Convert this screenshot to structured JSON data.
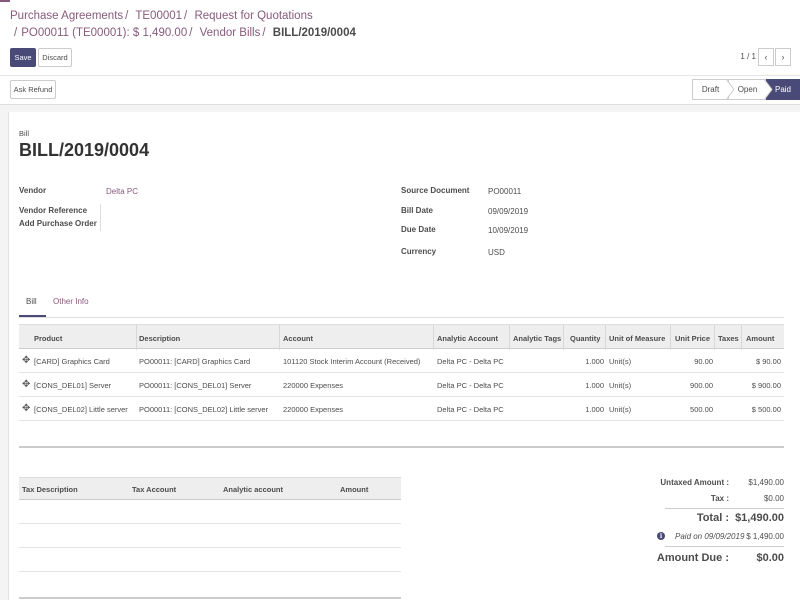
{
  "breadcrumb": {
    "line1": [
      "Purchase Agreements",
      "TE00001",
      "Request for Quotations"
    ],
    "line2": [
      "PO00011 (TE00001): $ 1,490.00",
      "Vendor Bills"
    ],
    "current": "BILL/2019/0004",
    "separator": "/"
  },
  "toolbar": {
    "save_label": "Save",
    "discard_label": "Discard",
    "pager": "1 / 1",
    "prev_icon": "‹",
    "next_icon": "›"
  },
  "actions": {
    "ask_refund_label": "Ask Refund"
  },
  "statusbar": {
    "draft": "Draft",
    "open": "Open",
    "paid": "Paid",
    "active": "paid"
  },
  "doc": {
    "kind": "Bill",
    "name": "BILL/2019/0004"
  },
  "fields_left": {
    "vendor_label": "Vendor",
    "vendor_value": "Delta PC",
    "vendor_ref_label": "Vendor Reference",
    "add_po_label": "Add Purchase Order"
  },
  "fields_right": {
    "source_label": "Source Document",
    "source_value": "PO00011",
    "bill_date_label": "Bill Date",
    "bill_date_value": "09/09/2019",
    "due_date_label": "Due Date",
    "due_date_value": "10/09/2019",
    "currency_label": "Currency",
    "currency_value": "USD"
  },
  "tabs": {
    "bill": "Bill",
    "other": "Other Info"
  },
  "lines": {
    "headers": {
      "product": "Product",
      "description": "Description",
      "account": "Account",
      "analytic_account": "Analytic Account",
      "analytic_tags": "Analytic Tags",
      "quantity": "Quantity",
      "uom": "Unit of Measure",
      "unit_price": "Unit Price",
      "taxes": "Taxes",
      "amount": "Amount"
    },
    "rows": [
      {
        "product": "[CARD] Graphics Card",
        "description": "PO00011: [CARD] Graphics Card",
        "account": "101120 Stock Interim Account (Received)",
        "analytic_account": "Delta PC - Delta PC",
        "quantity": "1.000",
        "uom": "Unit(s)",
        "unit_price": "90.00",
        "amount": "$ 90.00"
      },
      {
        "product": "[CONS_DEL01] Server",
        "description": "PO00011: [CONS_DEL01] Server",
        "account": "220000 Expenses",
        "analytic_account": "Delta PC - Delta PC",
        "quantity": "1.000",
        "uom": "Unit(s)",
        "unit_price": "900.00",
        "amount": "$ 900.00"
      },
      {
        "product": "[CONS_DEL02] Little server",
        "description": "PO00011: [CONS_DEL02] Little server",
        "account": "220000 Expenses",
        "analytic_account": "Delta PC - Delta PC",
        "quantity": "1.000",
        "uom": "Unit(s)",
        "unit_price": "500.00",
        "amount": "$ 500.00"
      }
    ]
  },
  "tax_table": {
    "headers": {
      "description": "Tax Description",
      "account": "Tax Account",
      "analytic": "Analytic account",
      "amount": "Amount"
    }
  },
  "totals": {
    "untaxed_label": "Untaxed Amount :",
    "untaxed_value": "$1,490.00",
    "tax_label": "Tax :",
    "tax_value": "$0.00",
    "total_label": "Total :",
    "total_value": "$1,490.00",
    "paid_on": "Paid on 09/09/2019",
    "paid_value": "$ 1,490.00",
    "due_label": "Amount Due :",
    "due_value": "$0.00"
  },
  "colors": {
    "primary": "#4a4a78",
    "link": "#875a7b"
  }
}
